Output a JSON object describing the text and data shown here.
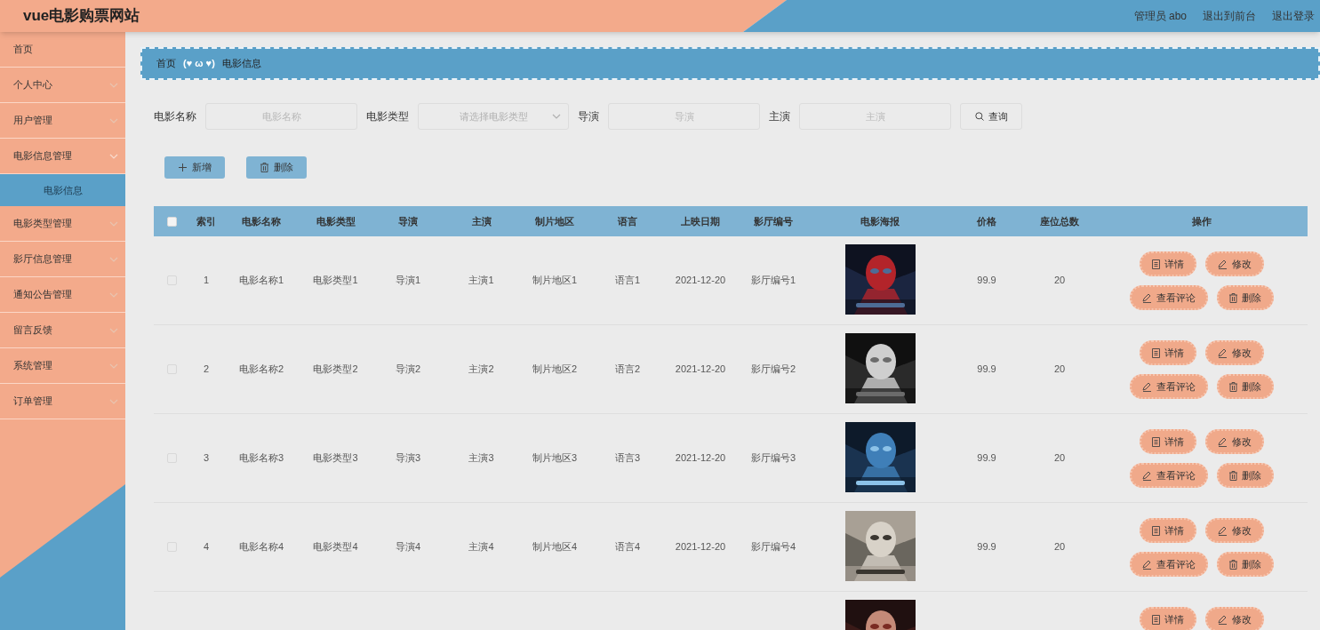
{
  "header": {
    "title": "vue电影购票网站",
    "links": [
      "管理员 abo",
      "退出到前台",
      "退出登录"
    ]
  },
  "sidebar": {
    "items": [
      {
        "label": "首页",
        "kind": "link",
        "selected": false
      },
      {
        "label": "个人中心",
        "kind": "submenu",
        "expanded": false,
        "selected": false
      },
      {
        "label": "用户管理",
        "kind": "submenu",
        "expanded": false,
        "selected": false
      },
      {
        "label": "电影信息管理",
        "kind": "submenu",
        "expanded": true,
        "selected": false,
        "children": [
          {
            "label": "电影信息",
            "selected": true
          }
        ]
      },
      {
        "label": "电影类型管理",
        "kind": "submenu",
        "expanded": false,
        "selected": false
      },
      {
        "label": "影厅信息管理",
        "kind": "submenu",
        "expanded": false,
        "selected": false
      },
      {
        "label": "通知公告管理",
        "kind": "submenu",
        "expanded": false,
        "selected": false
      },
      {
        "label": "留言反馈",
        "kind": "submenu",
        "expanded": false,
        "selected": false
      },
      {
        "label": "系统管理",
        "kind": "submenu",
        "expanded": false,
        "selected": false
      },
      {
        "label": "订单管理",
        "kind": "submenu",
        "expanded": false,
        "selected": false
      }
    ]
  },
  "breadcrumb": [
    "首页",
    "(♥ ω ♥)",
    "电影信息"
  ],
  "filters": [
    {
      "label": "电影名称",
      "kind": "input",
      "placeholder": "电影名称"
    },
    {
      "label": "电影类型",
      "kind": "select",
      "placeholder": "请选择电影类型"
    },
    {
      "label": "导演",
      "kind": "input",
      "placeholder": "导演"
    },
    {
      "label": "主演",
      "kind": "input",
      "placeholder": "主演"
    }
  ],
  "search_button": "查询",
  "toolbar": [
    {
      "label": "新增",
      "kind": "add"
    },
    {
      "label": "删除",
      "kind": "delete"
    }
  ],
  "table": {
    "header_checked": false,
    "columns": [
      "索引",
      "电影名称",
      "电影类型",
      "导演",
      "主演",
      "制片地区",
      "语言",
      "上映日期",
      "影厅编号",
      "电影海报",
      "价格",
      "座位总数",
      "操作"
    ],
    "rows": [
      {
        "checked": false,
        "cells": [
          "1",
          "电影名称1",
          "电影类型1",
          "导演1",
          "主演1",
          "制片地区1",
          "语言1",
          "2021-12-20",
          "影厅编号1"
        ],
        "poster": {
          "kind": "picture"
        },
        "price": "99.9",
        "seats": "20",
        "actions": [
          {
            "label": "详情",
            "kind": "detail"
          },
          {
            "label": "修改",
            "kind": "edit"
          },
          {
            "label": "查看评论",
            "kind": "edit"
          },
          {
            "label": "删除",
            "kind": "delete"
          }
        ]
      },
      {
        "checked": false,
        "cells": [
          "2",
          "电影名称2",
          "电影类型2",
          "导演2",
          "主演2",
          "制片地区2",
          "语言2",
          "2021-12-20",
          "影厅编号2"
        ],
        "poster": {
          "kind": "picture"
        },
        "price": "99.9",
        "seats": "20",
        "actions": [
          {
            "label": "详情",
            "kind": "detail"
          },
          {
            "label": "修改",
            "kind": "edit"
          },
          {
            "label": "查看评论",
            "kind": "edit"
          },
          {
            "label": "删除",
            "kind": "delete"
          }
        ]
      },
      {
        "checked": false,
        "cells": [
          "3",
          "电影名称3",
          "电影类型3",
          "导演3",
          "主演3",
          "制片地区3",
          "语言3",
          "2021-12-20",
          "影厅编号3"
        ],
        "poster": {
          "kind": "picture"
        },
        "price": "99.9",
        "seats": "20",
        "actions": [
          {
            "label": "详情",
            "kind": "detail"
          },
          {
            "label": "修改",
            "kind": "edit"
          },
          {
            "label": "查看评论",
            "kind": "edit"
          },
          {
            "label": "删除",
            "kind": "delete"
          }
        ]
      },
      {
        "checked": false,
        "cells": [
          "4",
          "电影名称4",
          "电影类型4",
          "导演4",
          "主演4",
          "制片地区4",
          "语言4",
          "2021-12-20",
          "影厅编号4"
        ],
        "poster": {
          "kind": "picture"
        },
        "price": "99.9",
        "seats": "20",
        "actions": [
          {
            "label": "详情",
            "kind": "detail"
          },
          {
            "label": "修改",
            "kind": "edit"
          },
          {
            "label": "查看评论",
            "kind": "edit"
          },
          {
            "label": "删除",
            "kind": "delete"
          }
        ]
      },
      {
        "poster": {
          "kind": "picture"
        },
        "actions": [
          {
            "label": "详情",
            "kind": "detail"
          },
          {
            "label": "修改",
            "kind": "edit"
          }
        ]
      }
    ]
  }
}
